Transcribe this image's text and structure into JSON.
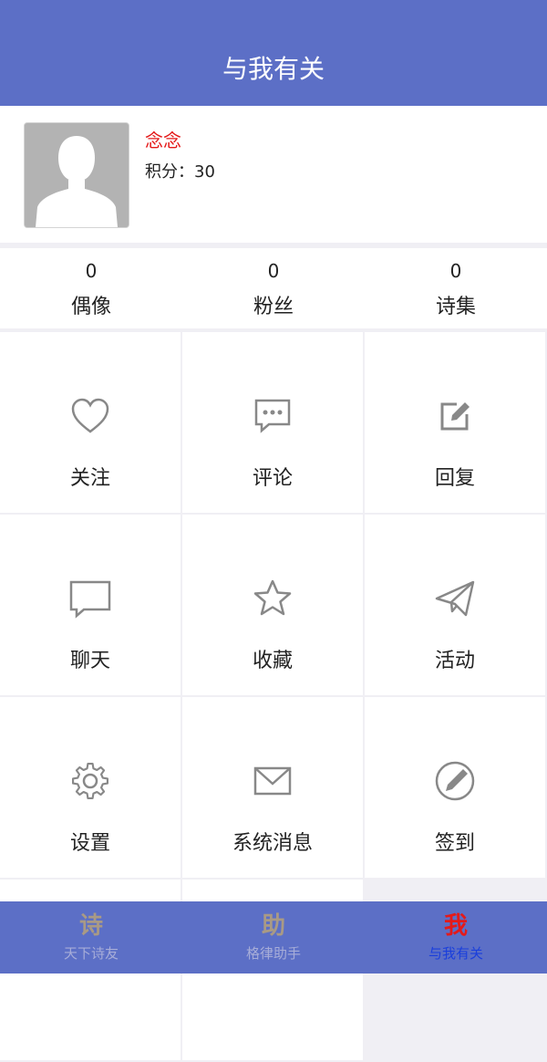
{
  "header": {
    "title": "与我有关"
  },
  "profile": {
    "username": "念念",
    "points_label": "积分：30"
  },
  "stats": [
    {
      "count": "0",
      "label": "偶像"
    },
    {
      "count": "0",
      "label": "粉丝"
    },
    {
      "count": "0",
      "label": "诗集"
    }
  ],
  "menu": [
    {
      "label": "关注",
      "icon": "heart-icon"
    },
    {
      "label": "评论",
      "icon": "comment-icon"
    },
    {
      "label": "回复",
      "icon": "edit-icon"
    },
    {
      "label": "聊天",
      "icon": "chat-icon"
    },
    {
      "label": "收藏",
      "icon": "star-icon"
    },
    {
      "label": "活动",
      "icon": "paper-plane-icon"
    },
    {
      "label": "设置",
      "icon": "gear-icon"
    },
    {
      "label": "系统消息",
      "icon": "mail-icon"
    },
    {
      "label": "签到",
      "icon": "pen-circle-icon"
    }
  ],
  "tabs": [
    {
      "glyph": "诗",
      "label": "天下诗友",
      "active": false
    },
    {
      "glyph": "助",
      "label": "格律助手",
      "active": false
    },
    {
      "glyph": "我",
      "label": "与我有关",
      "active": true
    }
  ],
  "colors": {
    "primary": "#5c6fc6",
    "username": "#e41a1a",
    "active_tab_glyph": "#e41a1a",
    "active_tab_label": "#1a3fdc",
    "inactive_tab_glyph": "#a99a85"
  }
}
